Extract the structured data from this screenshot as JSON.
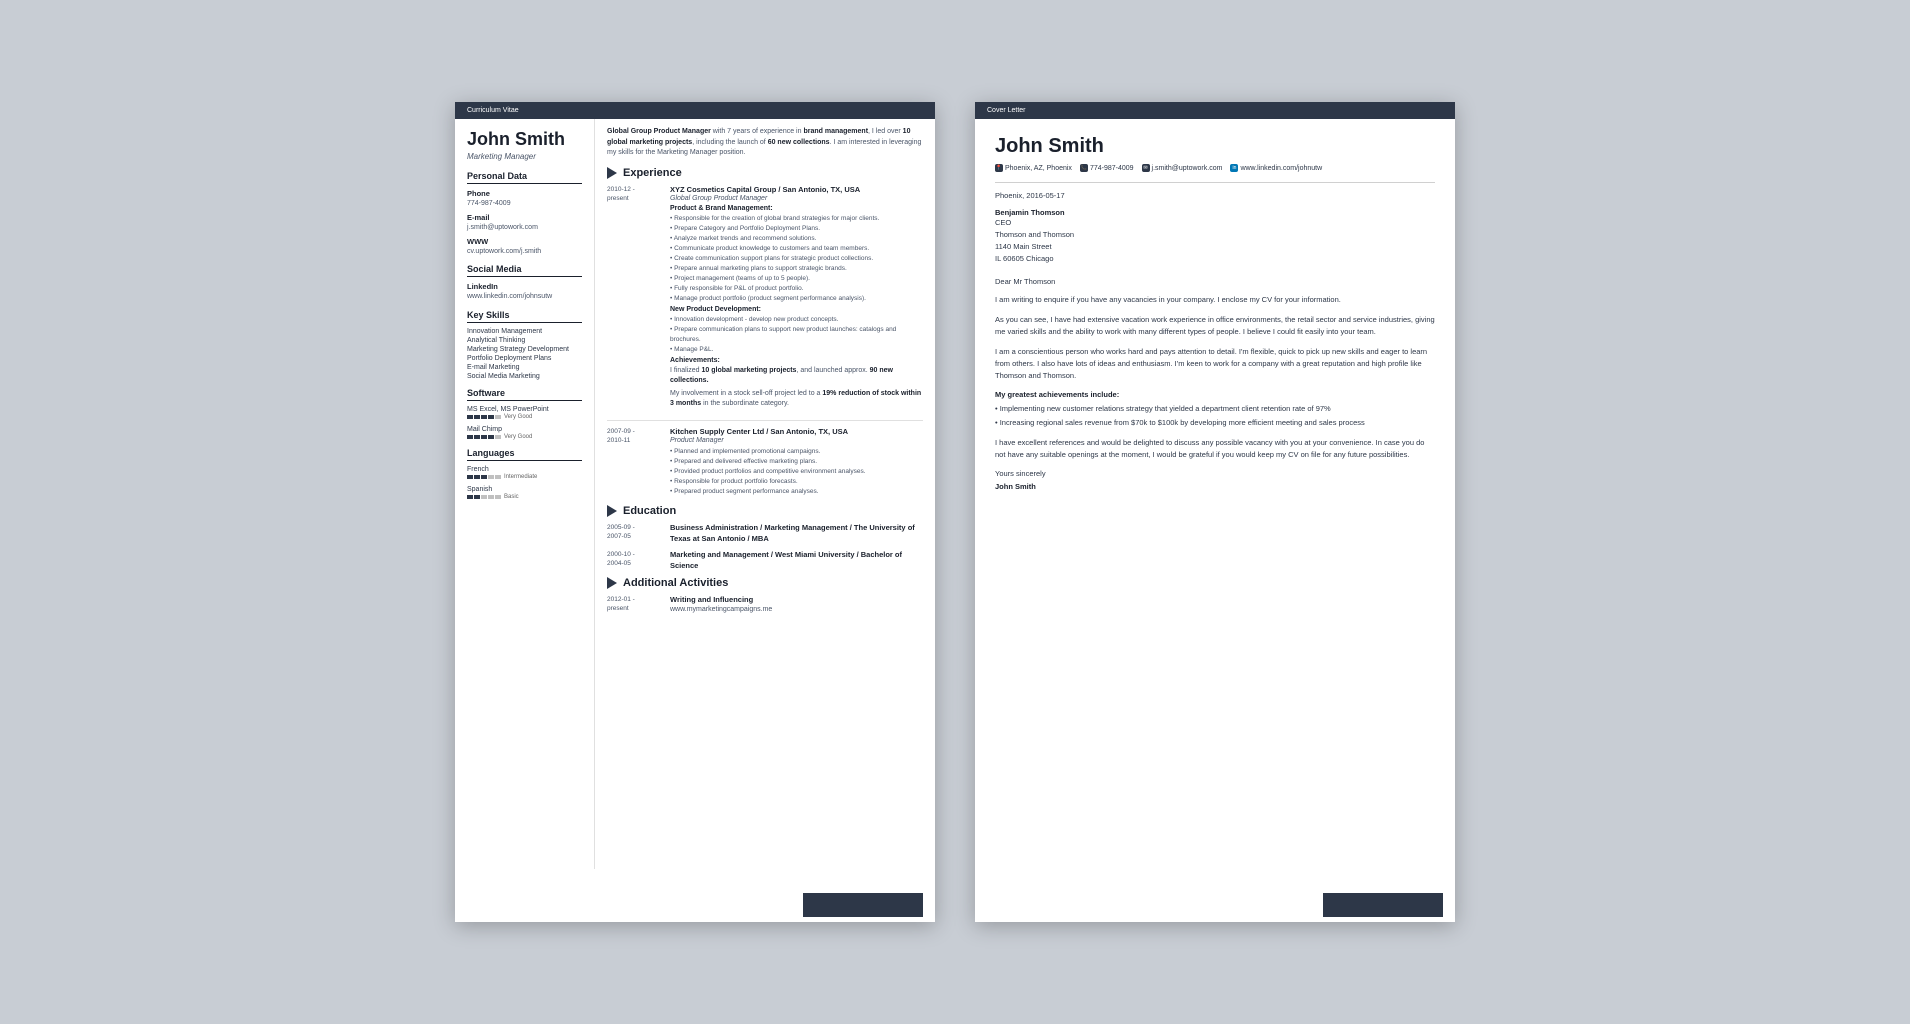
{
  "cv": {
    "header_label": "Curriculum Vitae",
    "name": "John Smith",
    "job_title": "Marketing Manager",
    "personal_data": {
      "section_title": "Personal Data",
      "phone_label": "Phone",
      "phone": "774-987-4009",
      "email_label": "E-mail",
      "email": "j.smith@uptowork.com",
      "www_label": "WWW",
      "www": "cv.uptowork.com/j.smith"
    },
    "social_media": {
      "section_title": "Social Media",
      "linkedin_label": "LinkedIn",
      "linkedin": "www.linkedin.com/johnsutw"
    },
    "key_skills": {
      "section_title": "Key Skills",
      "items": [
        "Innovation Management",
        "Analytical Thinking",
        "Marketing Strategy Development",
        "Portfolio Deployment Plans",
        "E-mail Marketing",
        "Social Media Marketing"
      ]
    },
    "software": {
      "section_title": "Software",
      "items": [
        {
          "name": "MS Excel, MS PowerPoint",
          "rating": 4,
          "max": 5,
          "label": "Very Good"
        },
        {
          "name": "Mail Chimp",
          "rating": 4,
          "max": 5,
          "label": "Very Good"
        }
      ]
    },
    "languages": {
      "section_title": "Languages",
      "items": [
        {
          "name": "French",
          "rating": 3,
          "max": 5,
          "label": "Intermediate"
        },
        {
          "name": "Spanish",
          "rating": 2,
          "max": 5,
          "label": "Basic"
        }
      ]
    },
    "intro": "Global Group Product Manager with 7 years of experience in brand management, I led over 10 global marketing projects, including the launch of 60 new collections. I am interested in leveraging my skills for the Marketing Manager position.",
    "experience": {
      "section_title": "Experience",
      "entries": [
        {
          "dates": "2010-12 - present",
          "company": "XYZ Cosmetics Capital Group / San Antonio, TX, USA",
          "job_title": "Global Group Product Manager",
          "subsections": [
            {
              "title": "Product & Brand Management:",
              "bullets": [
                "Responsible for the creation of global brand strategies for major clients.",
                "Prepare Category and Portfolio Deployment Plans.",
                "Analyze market trends and recommend solutions.",
                "Communicate product knowledge to customers and team members.",
                "Create communication support plans for strategic product collections.",
                "Prepare annual marketing plans to support strategic brands.",
                "Project management (teams of up to 5 people).",
                "Fully responsible for P&L of product portfolio.",
                "Manage product portfolio (product segment performance analysis)."
              ]
            },
            {
              "title": "New Product Development:",
              "bullets": [
                "Innovation development - develop new product concepts.",
                "Prepare communication plans to support new product launches: catalogs and brochures.",
                "Manage P&L."
              ]
            },
            {
              "title": "Achievements:",
              "achievement_text": "I finalized 10 global marketing projects, and launched approx. 90 new collections.",
              "achievement_text2": "My involvement in a stock sell-off project led to a 19% reduction of stock within 3 months in the subordinate category."
            }
          ]
        },
        {
          "dates": "2007-09 - 2010-11",
          "company": "Kitchen Supply Center Ltd / San Antonio, TX, USA",
          "job_title": "Product Manager",
          "bullets": [
            "Planned and implemented promotional campaigns.",
            "Prepared and delivered effective marketing plans.",
            "Provided product portfolios and competitive environment analyses.",
            "Responsible for product portfolio forecasts.",
            "Prepared product segment performance analyses."
          ]
        }
      ]
    },
    "education": {
      "section_title": "Education",
      "entries": [
        {
          "dates": "2005-09 - 2007-05",
          "title": "Business Administration / Marketing Management / The University of Texas at San Antonio / MBA"
        },
        {
          "dates": "2000-10 - 2004-05",
          "title": "Marketing and Management / West Miami University / Bachelor of Science"
        }
      ]
    },
    "activities": {
      "section_title": "Additional Activities",
      "entries": [
        {
          "dates": "2012-01 - present",
          "title": "Writing and Influencing",
          "url": "www.mymarketingcampaigns.me"
        }
      ]
    },
    "button_label": ""
  },
  "cover_letter": {
    "header_label": "Cover Letter",
    "name": "John Smith",
    "contact": {
      "location": "Phoenix, AZ, Phoenix",
      "phone": "774-987-4009",
      "email": "j.smith@uptowork.com",
      "linkedin": "www.linkedin.com/johnutw"
    },
    "date": "Phoenix, 2016-05-17",
    "recipient": {
      "name": "Benjamin Thomson",
      "title": "CEO",
      "company": "Thomson and Thomson",
      "address": "1140 Main Street",
      "city": "IL 60605 Chicago"
    },
    "greeting": "Dear Mr Thomson",
    "paragraphs": [
      "I am writing to enquire if you have any vacancies in your company. I enclose my CV for your information.",
      "As you can see, I have had extensive vacation work experience in office environments, the retail sector and service industries, giving me varied skills and the ability to work with many different types of people. I believe I could fit easily into your team.",
      "I am a conscientious person who works hard and pays attention to detail. I'm flexible, quick to pick up new skills and eager to learn from others. I also have lots of ideas and enthusiasm. I'm keen to work for a company with a great reputation and high profile like Thomson and Thomson."
    ],
    "achievements_title": "My greatest achievements include:",
    "achievements": [
      "Implementing new customer relations strategy that yielded a department client retention rate of 97%",
      "Increasing regional sales revenue from $70k to $100k by developing more efficient meeting and sales process"
    ],
    "closing_paragraph": "I have excellent references and would be delighted to discuss any possible vacancy with you at your convenience. In case you do not have any suitable openings at the moment, I would be grateful if you would keep my CV on file for any future possibilities.",
    "sign_off": "Yours sincerely",
    "signature": "John Smith",
    "button_label": ""
  }
}
